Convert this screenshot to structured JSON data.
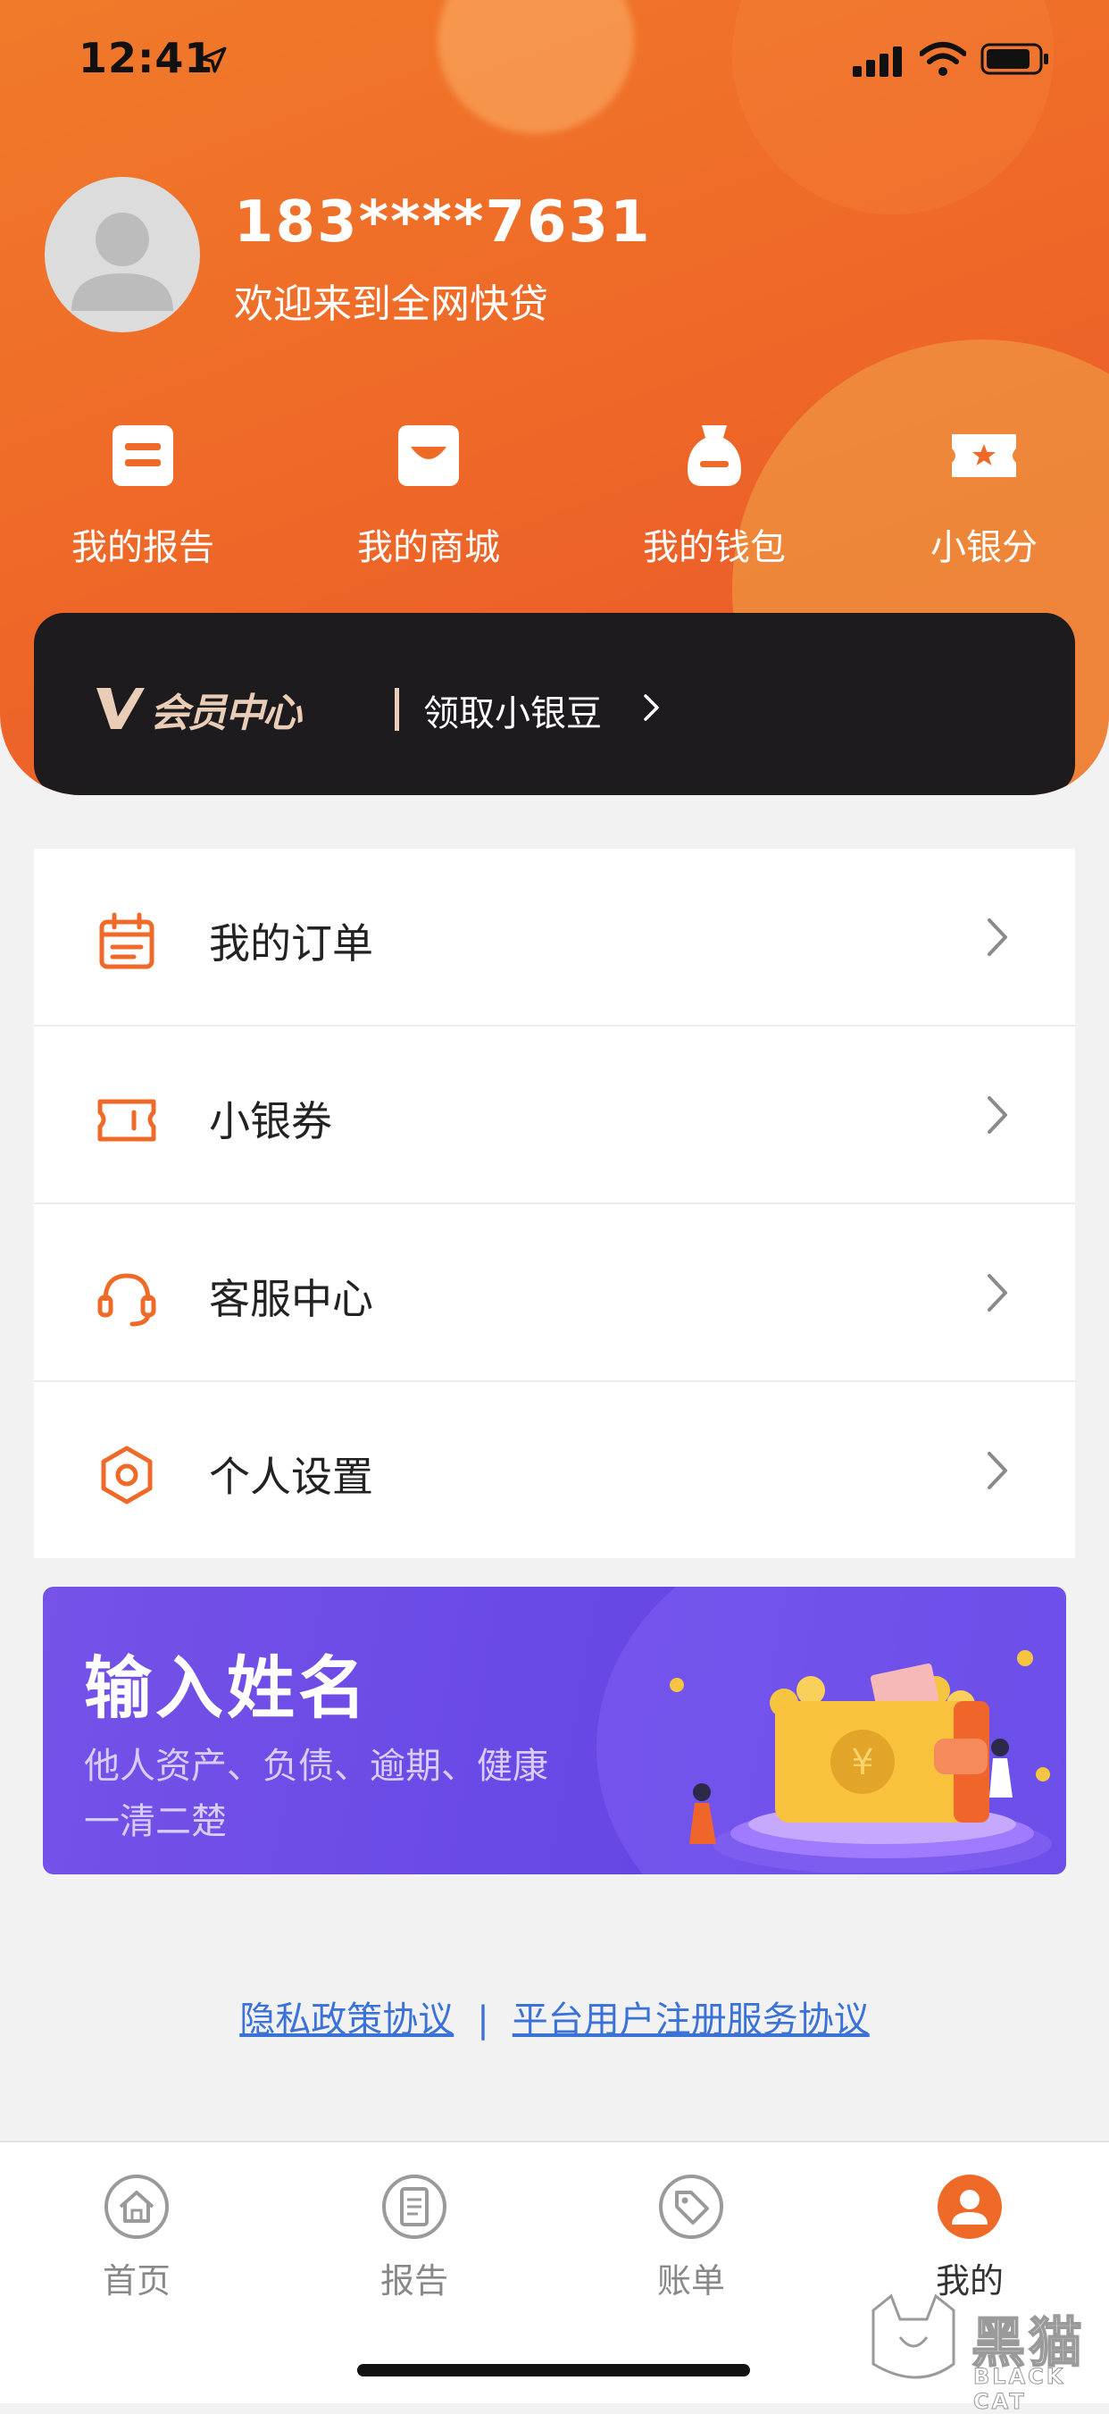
{
  "status_bar": {
    "time": "12:41"
  },
  "profile": {
    "phone": "183****7631",
    "welcome": "欢迎来到全网快贷"
  },
  "quick_actions": [
    {
      "label": "我的报告",
      "icon": "report-icon"
    },
    {
      "label": "我的商城",
      "icon": "shop-icon"
    },
    {
      "label": "我的钱包",
      "icon": "wallet-icon"
    },
    {
      "label": "小银分",
      "icon": "ticket-star-icon"
    }
  ],
  "vip": {
    "title": "会员中心",
    "link": "领取小银豆"
  },
  "menu": [
    {
      "label": "我的订单",
      "icon": "calendar-icon"
    },
    {
      "label": "小银券",
      "icon": "coupon-icon"
    },
    {
      "label": "客服中心",
      "icon": "headset-icon"
    },
    {
      "label": "个人设置",
      "icon": "settings-icon"
    }
  ],
  "banner": {
    "title": "输入姓名",
    "line1": "他人资产、负债、逾期、健康",
    "line2": "一清二楚"
  },
  "links": {
    "privacy": "隐私政策协议",
    "separator": "|",
    "terms": "平台用户注册服务协议"
  },
  "tabs": [
    {
      "label": "首页",
      "icon": "home-icon"
    },
    {
      "label": "报告",
      "icon": "document-icon"
    },
    {
      "label": "账单",
      "icon": "tag-icon"
    },
    {
      "label": "我的",
      "icon": "user-icon",
      "active": true
    }
  ],
  "watermark": {
    "name": "黑猫",
    "sub": "BLACK CAT"
  },
  "colors": {
    "accent": "#ef6a28",
    "link": "#3a72d8",
    "vip_bg": "#1d1b1d",
    "banner": "#6a4ae6"
  }
}
